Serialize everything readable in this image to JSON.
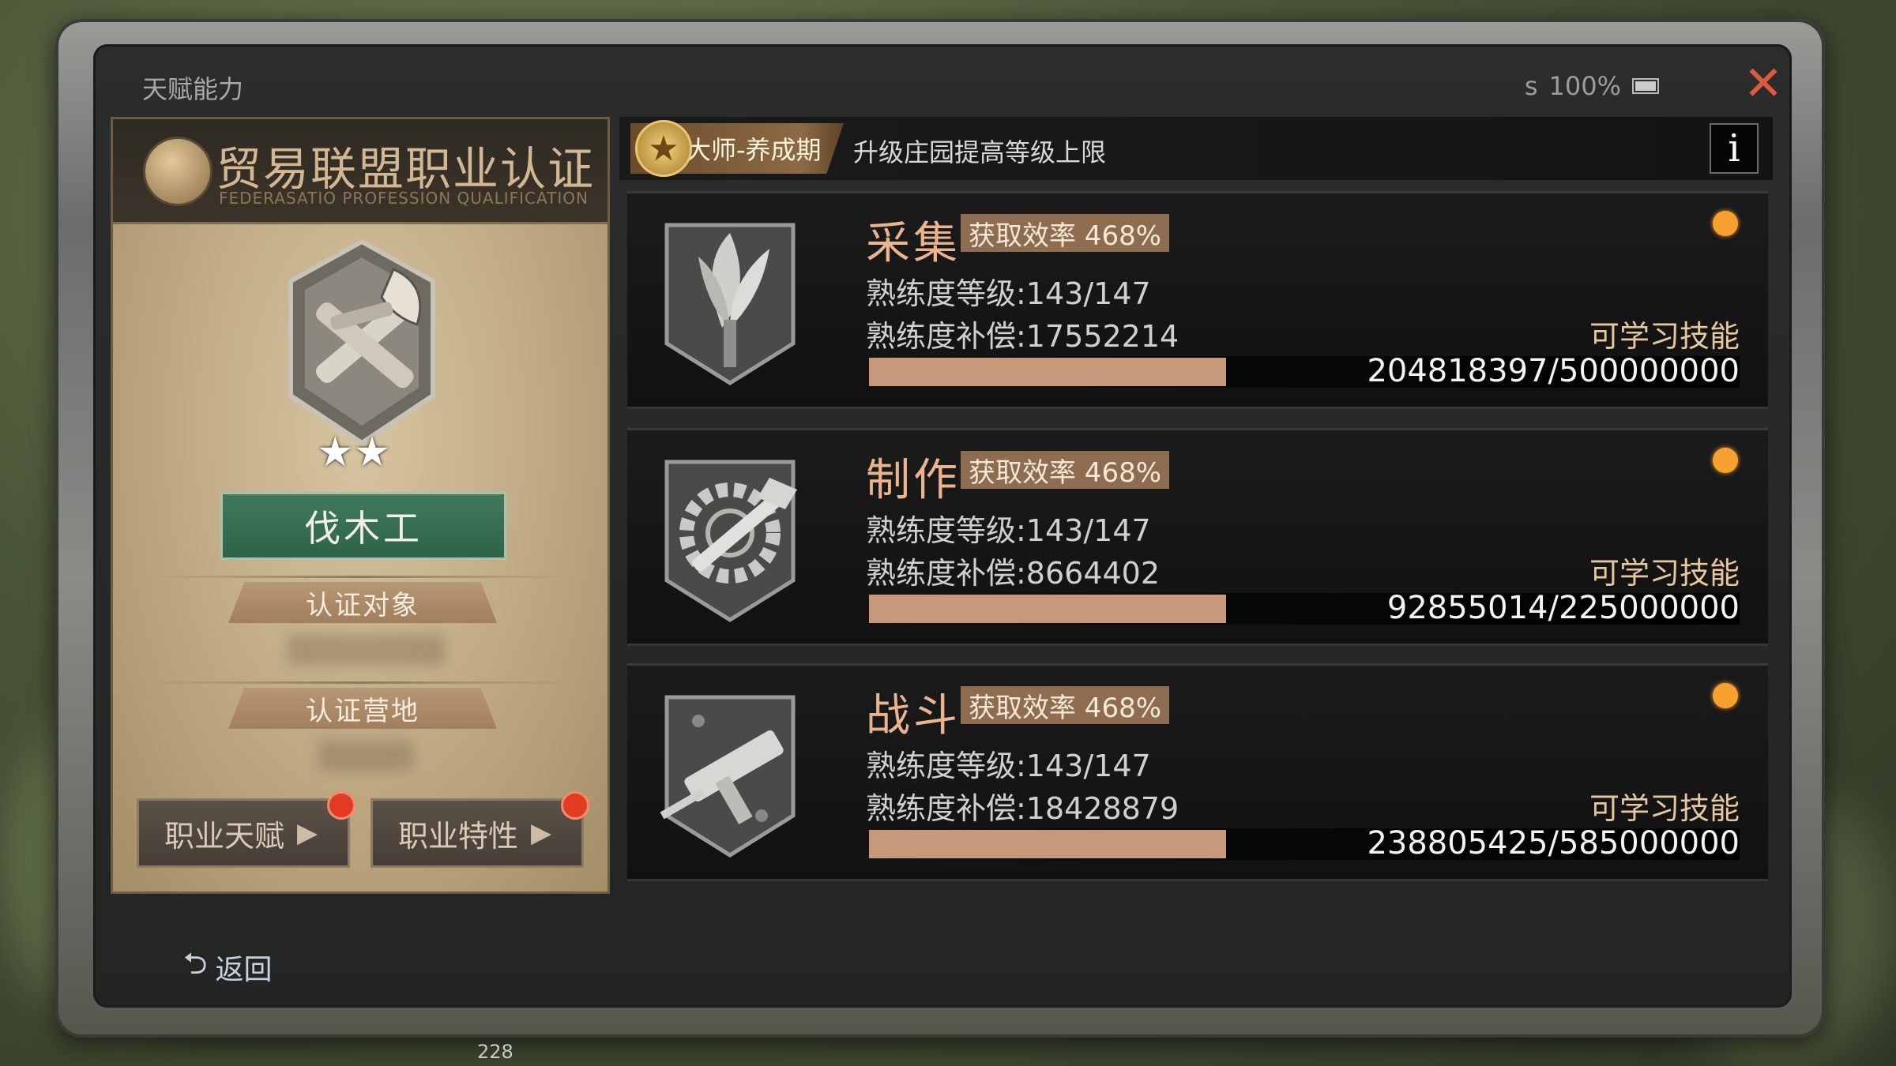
{
  "window": {
    "title": "天赋能力",
    "battery_text": "100%",
    "status_prefix": "s",
    "close_icon": "close-icon"
  },
  "cert": {
    "title": "贸易联盟职业认证",
    "subtitle": "FEDERASATIO PROFESSION QUALIFICATION",
    "job_name": "伐木工",
    "stars": 2,
    "star_glyphs": "★★",
    "target_label": "认证对象",
    "camp_label": "认证营地",
    "talent_button": "职业天赋",
    "trait_button": "职业特性",
    "arrow": "▶"
  },
  "master": {
    "badge": "大师-养成期",
    "description": "升级庄园提高等级上限",
    "info": "i",
    "star_glyph": "★"
  },
  "skills": [
    {
      "name": "采集",
      "rate": "获取效率 468%",
      "level": "熟练度等级:143/147",
      "compensation": "熟练度补偿:17552214",
      "learn": "可学习技能",
      "progress": "204818397/500000000",
      "fraction": 0.41,
      "icon": "herb-icon"
    },
    {
      "name": "制作",
      "rate": "获取效率 468%",
      "level": "熟练度等级:143/147",
      "compensation": "熟练度补偿:8664402",
      "learn": "可学习技能",
      "progress": "92855014/225000000",
      "fraction": 0.41,
      "icon": "hammer-gear-icon"
    },
    {
      "name": "战斗",
      "rate": "获取效率 468%",
      "level": "熟练度等级:143/147",
      "compensation": "熟练度补偿:18428879",
      "learn": "可学习技能",
      "progress": "238805425/585000000",
      "fraction": 0.41,
      "icon": "submachine-gun-icon"
    }
  ],
  "footer": {
    "back": "返回",
    "back_icon": "⮌",
    "number": "228"
  },
  "colors": {
    "accent_orange": "#f6a12f",
    "bar_fill": "#c8987b",
    "rate_badge": "#8d6c4f",
    "job_green": "#3f7a5c",
    "close_red": "#e0593e"
  }
}
